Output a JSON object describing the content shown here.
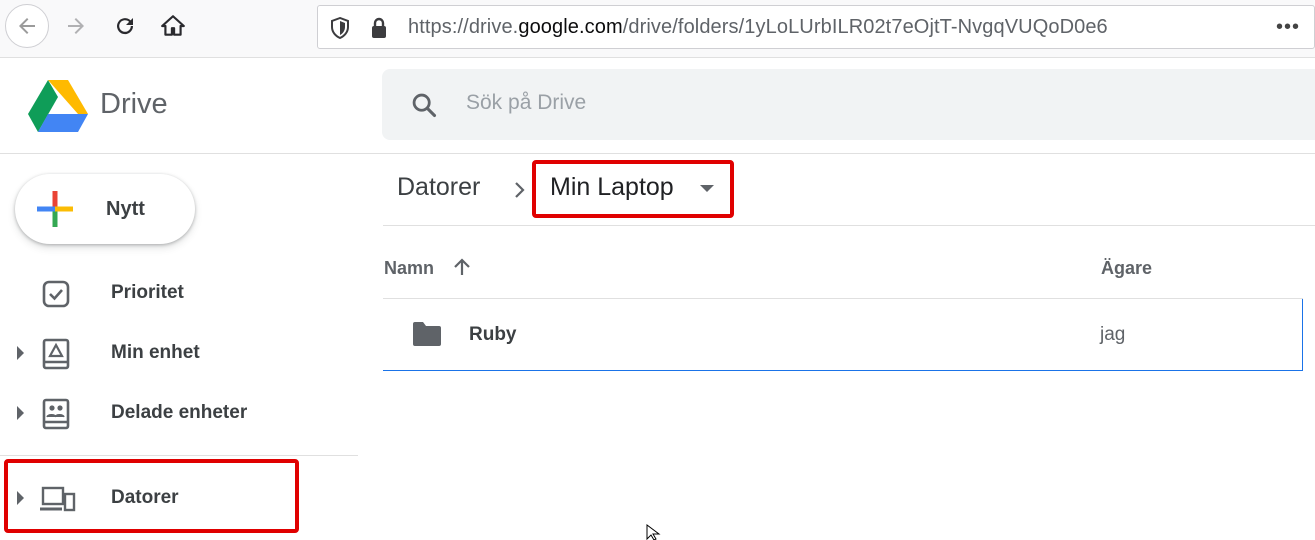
{
  "browser": {
    "url_prefix": "https://drive.",
    "url_domain": "google.com",
    "url_path": "/drive/folders/1yLoLUrbILR02t7eOjtT-NvgqVUQoD0e6",
    "more_label": "•••"
  },
  "app": {
    "name": "Drive",
    "search_placeholder": "Sök på Drive"
  },
  "sidebar": {
    "new_label": "Nytt",
    "items": [
      {
        "label": "Prioritet",
        "icon": "priority-check-icon"
      },
      {
        "label": "Min enhet",
        "icon": "my-drive-icon"
      },
      {
        "label": "Delade enheter",
        "icon": "shared-drives-icon"
      },
      {
        "label": "Datorer",
        "icon": "computers-icon"
      }
    ]
  },
  "breadcrumb": {
    "root": "Datorer",
    "current": "Min Laptop"
  },
  "list": {
    "columns": {
      "name": "Namn",
      "owner": "Ägare"
    },
    "rows": [
      {
        "name": "Ruby",
        "owner": "jag",
        "icon": "folder-icon"
      }
    ]
  },
  "colors": {
    "highlight": "#e00000",
    "selection_border": "#1a73e8"
  }
}
